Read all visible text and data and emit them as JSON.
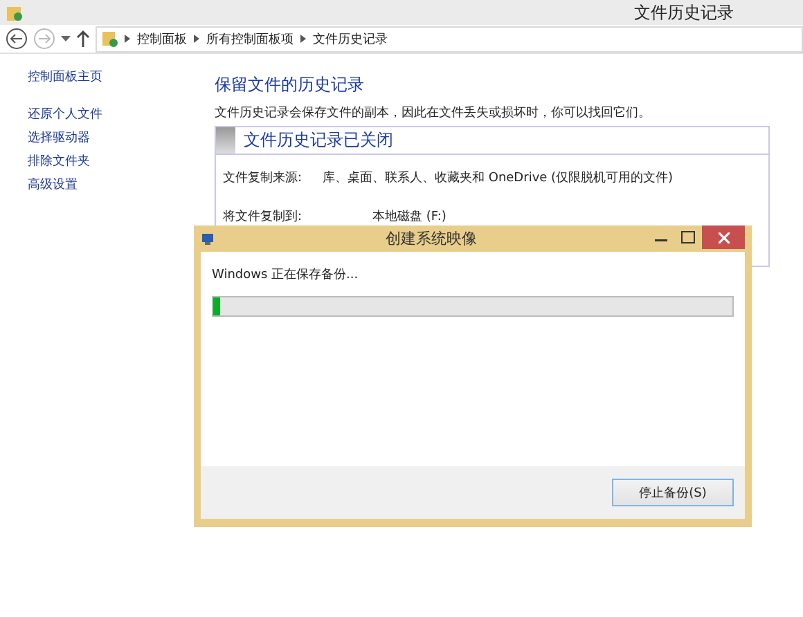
{
  "window": {
    "title": "文件历史记录"
  },
  "breadcrumb": [
    "控制面板",
    "所有控制面板项",
    "文件历史记录"
  ],
  "sidebar": {
    "items": [
      {
        "label": "控制面板主页"
      },
      {
        "label": "还原个人文件"
      },
      {
        "label": "选择驱动器"
      },
      {
        "label": "排除文件夹"
      },
      {
        "label": "高级设置"
      }
    ]
  },
  "main": {
    "heading": "保留文件的历史记录",
    "description": "文件历史记录会保存文件的副本，因此在文件丢失或损坏时，你可以找回它们。",
    "status_title": "文件历史记录已关闭",
    "rows": [
      {
        "label": "文件复制来源:",
        "value": "库、桌面、联系人、收藏夹和 OneDrive (仅限脱机可用的文件)"
      },
      {
        "label": "将文件复制到:",
        "value": "本地磁盘 (F:)"
      }
    ]
  },
  "dialog": {
    "title": "创建系统映像",
    "message": "Windows 正在保存备份...",
    "progress": {
      "level": 0.012
    },
    "button": "停止备份(S)"
  }
}
